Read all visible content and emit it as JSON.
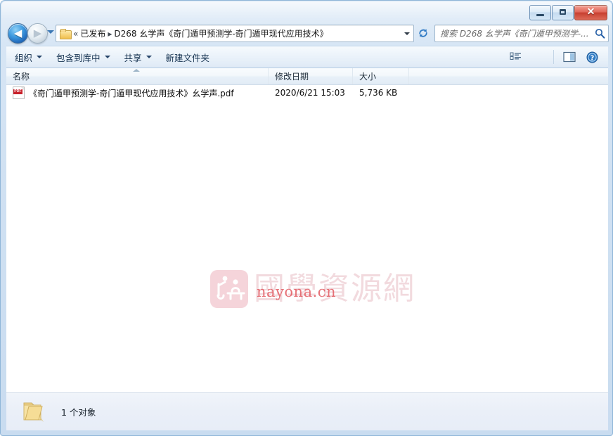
{
  "window": {
    "controls": {
      "minimize_label": "–",
      "maximize_label": "□",
      "close_label": "✕"
    }
  },
  "nav": {
    "back_glyph": "◀",
    "forward_glyph": "▶",
    "folder_icon": "folder-icon",
    "separator": "▸",
    "crumb_chevrons": "«",
    "breadcrumbs": [
      "已发布",
      "D268 幺学声《奇门遁甲预测学-奇门遁甲现代应用技术》"
    ]
  },
  "search": {
    "placeholder": "搜索 D268 幺学声《奇门遁甲预测学-...",
    "icon": "search-icon"
  },
  "toolbar": {
    "items": [
      {
        "label": "组织",
        "has_caret": true
      },
      {
        "label": "包含到库中",
        "has_caret": true
      },
      {
        "label": "共享",
        "has_caret": true
      },
      {
        "label": "新建文件夹",
        "has_caret": false
      }
    ],
    "right_icons": [
      "view-options-icon",
      "view-options-caret",
      "preview-pane-icon",
      "help-icon"
    ]
  },
  "columns": {
    "name": "名称",
    "date": "修改日期",
    "size": "大小",
    "sort_column": "名称",
    "sort_direction": "ascending"
  },
  "files": [
    {
      "icon": "pdf-file-icon",
      "icon_label": "PDF",
      "name": "《奇门遁甲预测学-奇门遁甲现代应用技术》幺学声.pdf",
      "date": "2020/6/21 15:03",
      "size": "5,736 KB"
    }
  ],
  "watermark": {
    "text": "國學資源網",
    "url": "nayona.cn",
    "logo_color": "#f5d4da",
    "text_color": "#f2dade",
    "url_color": "#e2555c"
  },
  "status": {
    "icon": "folder-icon",
    "text": "1 个对象"
  },
  "colors": {
    "frame": "#cfe0f2",
    "accent": "#1f63b5",
    "close_red": "#c73f30",
    "content_bg": "#ffffff"
  }
}
